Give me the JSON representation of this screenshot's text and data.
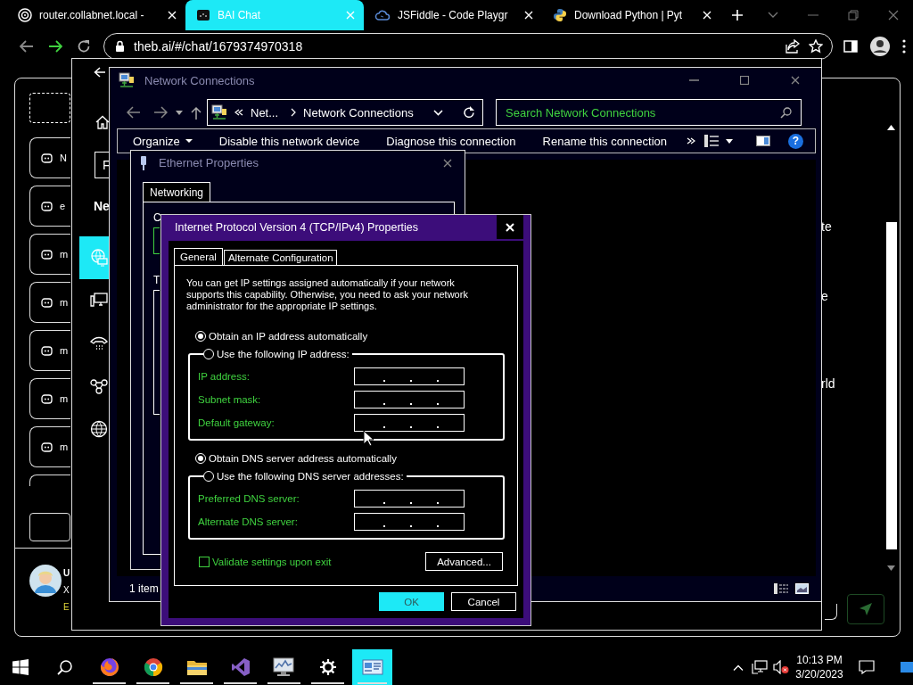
{
  "browser": {
    "tabs": [
      {
        "title": "router.collabnet.local -",
        "kind": "router",
        "selected": false
      },
      {
        "title": "BAI Chat",
        "kind": "chat",
        "selected": true
      },
      {
        "title": "JSFiddle - Code Playgr",
        "kind": "fiddle",
        "selected": false
      },
      {
        "title": "Download Python | Pyt",
        "kind": "python",
        "selected": false
      }
    ],
    "url": "theb.ai/#/chat/1679374970318"
  },
  "chat": {
    "conversations": [
      {
        "title": "N"
      },
      {
        "title": "e"
      },
      {
        "title": "m"
      },
      {
        "title": "m"
      },
      {
        "title": "m"
      },
      {
        "title": "m"
      },
      {
        "title": "m"
      }
    ],
    "messages": [
      {
        "text": "te"
      },
      {
        "text": "e"
      },
      {
        "text": "rld"
      }
    ],
    "user": {
      "name": "U",
      "line_2": "X",
      "line_3": "E"
    }
  },
  "settings_window": {
    "search": {
      "value": "F"
    },
    "heading": "Ne",
    "nav": [
      {
        "kind": "status",
        "selected": true
      },
      {
        "kind": "ethernet",
        "selected": false
      },
      {
        "kind": "dialup",
        "selected": false
      },
      {
        "kind": "vpn",
        "selected": false
      },
      {
        "kind": "proxy",
        "selected": false
      }
    ]
  },
  "network_connections": {
    "title": "Network Connections",
    "path": [
      "Net...",
      "Network Connections"
    ],
    "search": {
      "placeholder": "Search Network Connections"
    },
    "toolbar": [
      {
        "label": "Organize",
        "kind": "menu"
      },
      {
        "label": "Disable this network device",
        "kind": "command"
      },
      {
        "label": "Diagnose this connection",
        "kind": "command"
      },
      {
        "label": "Rename this connection",
        "kind": "command"
      }
    ],
    "help": "?",
    "status_bar": "1 item"
  },
  "ethernet_properties": {
    "title": "Ethernet Properties",
    "tabs": [
      {
        "label": "Networking",
        "selected": true
      }
    ],
    "labels": [
      "C",
      "T"
    ]
  },
  "ipv4_properties": {
    "title": "Internet Protocol Version 4 (TCP/IPv4) Properties",
    "tabs": [
      {
        "label": "General",
        "selected": true
      },
      {
        "label": "Alternate Configuration",
        "selected": false
      }
    ],
    "description": "You can get IP settings assigned automatically if your network supports this capability. Otherwise, you need to ask your network administrator for the appropriate IP settings.",
    "ip_options": [
      {
        "label": "Obtain an IP address automatically",
        "selected": true
      },
      {
        "label": "Use the following IP address:",
        "selected": false
      }
    ],
    "ip_fields": [
      {
        "label": "IP address:",
        "disabled": true
      },
      {
        "label": "Subnet mask:",
        "disabled": true
      },
      {
        "label": "Default gateway:",
        "disabled": true
      }
    ],
    "dns_options": [
      {
        "label": "Obtain DNS server address automatically",
        "selected": true
      },
      {
        "label": "Use the following DNS server addresses:",
        "selected": false
      }
    ],
    "dns_fields": [
      {
        "label": "Preferred DNS server:",
        "disabled": true
      },
      {
        "label": "Alternate DNS server:",
        "disabled": true
      }
    ],
    "validate": {
      "label": "Validate settings upon exit",
      "checked": false,
      "disabled": true
    },
    "advanced_button": "Advanced...",
    "buttons": [
      {
        "label": "OK",
        "default": true
      },
      {
        "label": "Cancel",
        "default": false
      }
    ]
  },
  "taskbar": {
    "apps": [
      {
        "kind": "firefox",
        "running": true,
        "active": false
      },
      {
        "kind": "chrome",
        "running": true,
        "active": false
      },
      {
        "kind": "explorer",
        "running": true,
        "active": false
      },
      {
        "kind": "studio",
        "running": true,
        "active": false
      },
      {
        "kind": "monitor",
        "running": true,
        "active": false
      },
      {
        "kind": "settings",
        "running": true,
        "active": false
      },
      {
        "kind": "network",
        "running": true,
        "active": true
      }
    ],
    "clock": {
      "time": "10:13 PM",
      "date": "3/20/2023"
    }
  }
}
